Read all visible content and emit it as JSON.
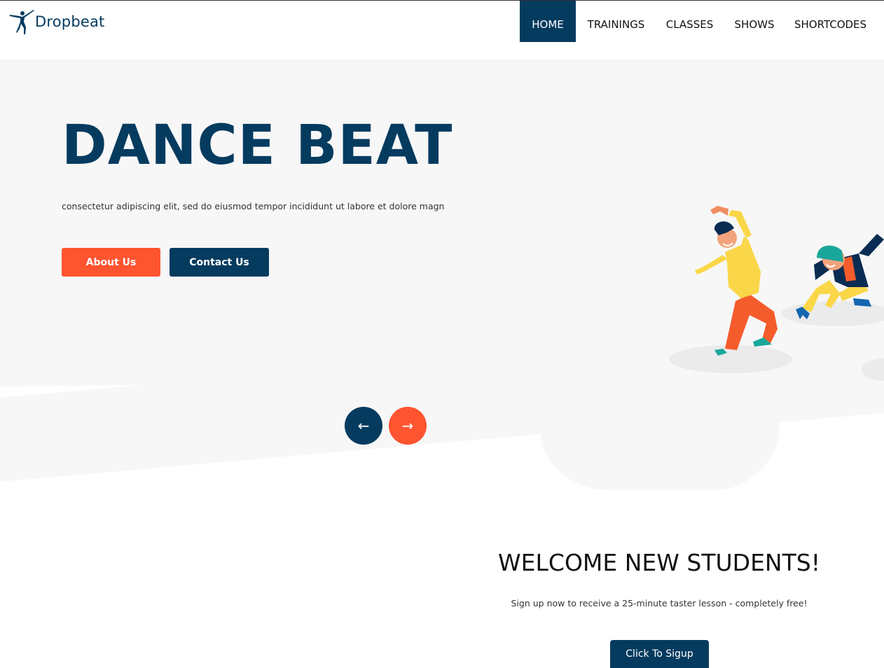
{
  "brand": {
    "name": "Dropbeat",
    "logo_icon": "ballerina-logo-icon",
    "color": "#053b5f"
  },
  "nav": {
    "items": [
      {
        "label": "HOME",
        "active": true
      },
      {
        "label": "TRAININGS",
        "active": false
      },
      {
        "label": "CLASSES",
        "active": false
      },
      {
        "label": "SHOWS",
        "active": false
      },
      {
        "label": "SHORTCODES",
        "active": false
      }
    ]
  },
  "hero": {
    "title": "DANCE BEAT",
    "subtitle": "consectetur adipiscing elit, sed do eiusmod tempor incididunt ut labore et dolore magn",
    "about_label": "About Us",
    "contact_label": "Contact Us",
    "prev_icon": "arrow-left-icon",
    "next_icon": "arrow-right-icon",
    "prev_glyph": "←",
    "next_glyph": "→",
    "illustration": "dancing-people-illustration"
  },
  "welcome": {
    "title": "WELCOME NEW STUDENTS!",
    "text": "Sign up now to receive a 25-minute taster lesson - completely free!",
    "signup_label": "Click To Sigup"
  },
  "colors": {
    "primary": "#053b5f",
    "accent": "#fe5430",
    "hero_bg": "#f7f7f7"
  }
}
